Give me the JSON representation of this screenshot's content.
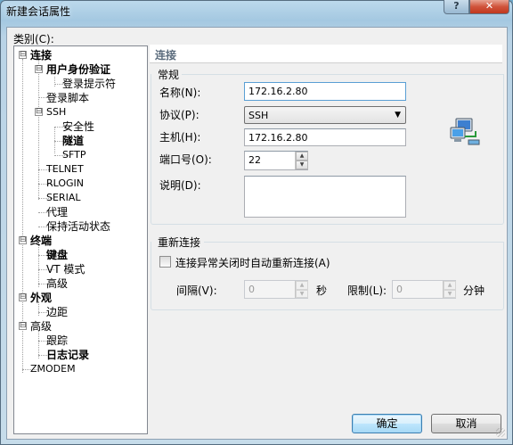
{
  "window": {
    "title": "新建会话属性",
    "help_glyph": "?",
    "close_glyph": "✕"
  },
  "category_label": "类别(C):",
  "tree": {
    "connection": "连接",
    "user_auth": "用户身份验证",
    "login_prompt": "登录提示符",
    "login_script": "登录脚本",
    "ssh": "SSH",
    "security": "安全性",
    "tunnel": "隧道",
    "sftp": "SFTP",
    "telnet": "TELNET",
    "rlogin": "RLOGIN",
    "serial": "SERIAL",
    "proxy": "代理",
    "keepalive": "保持活动状态",
    "terminal": "终端",
    "keyboard": "键盘",
    "vt_mode": "VT 模式",
    "advanced1": "高级",
    "appearance": "外观",
    "margin": "边距",
    "advanced2": "高级",
    "trace": "跟踪",
    "logging": "日志记录",
    "zmodem": "ZMODEM"
  },
  "panel": {
    "section_title": "连接",
    "general": {
      "title": "常规",
      "name_label": "名称(N):",
      "name_value": "172.16.2.80",
      "protocol_label": "协议(P):",
      "protocol_value": "SSH",
      "host_label": "主机(H):",
      "host_value": "172.16.2.80",
      "port_label": "端口号(O):",
      "port_value": "22",
      "desc_label": "说明(D):",
      "desc_value": ""
    },
    "reconnect": {
      "title": "重新连接",
      "checkbox_label": "连接异常关闭时自动重新连接(A)",
      "checked": false,
      "interval_label": "间隔(V):",
      "interval_value": "0",
      "interval_unit": "秒",
      "limit_label": "限制(L):",
      "limit_value": "0",
      "limit_unit": "分钟"
    }
  },
  "buttons": {
    "ok": "确定",
    "cancel": "取消"
  },
  "icons": {
    "expand": "⊟",
    "spin_up": "▲",
    "spin_down": "▼",
    "dropdown": "▼",
    "network_icon": "network-computers-icon"
  },
  "colors": {
    "accent": "#3c7fb1",
    "section_text": "#5a6b7c",
    "close_red": "#c0391f"
  }
}
